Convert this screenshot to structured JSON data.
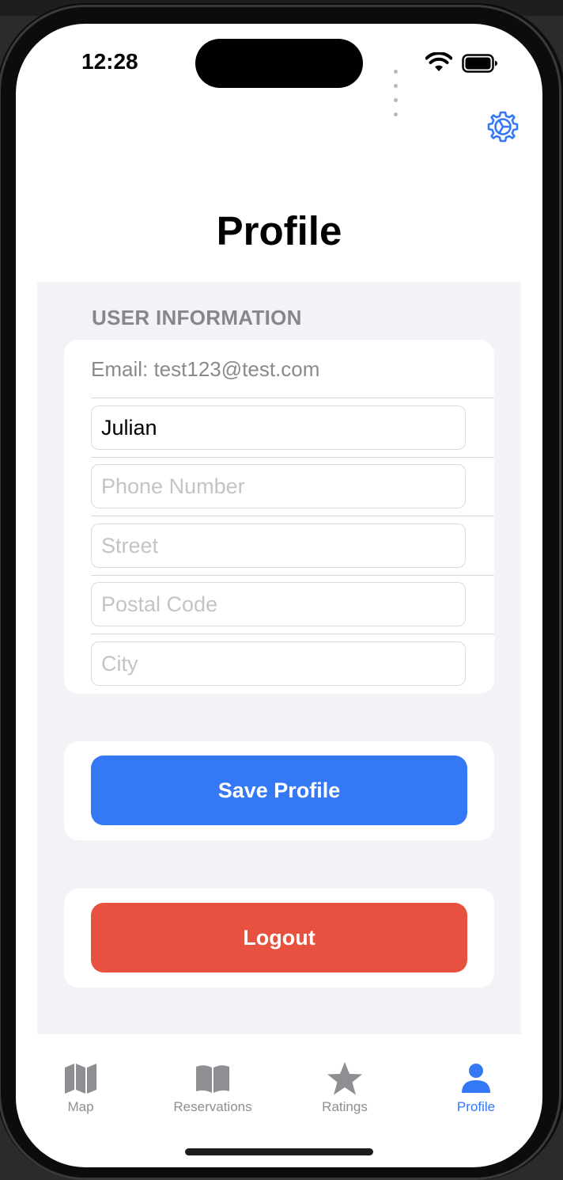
{
  "status_bar": {
    "time": "12:28"
  },
  "header": {
    "title": "Profile",
    "settings_icon": "gear-icon"
  },
  "user_information": {
    "section_header": "USER INFORMATION",
    "email_label": "Email: test123@test.com",
    "fields": {
      "name": {
        "value": "Julian",
        "placeholder": ""
      },
      "phone": {
        "value": "",
        "placeholder": "Phone Number"
      },
      "street": {
        "value": "",
        "placeholder": "Street"
      },
      "postal_code": {
        "value": "",
        "placeholder": "Postal Code"
      },
      "city": {
        "value": "",
        "placeholder": "City"
      }
    }
  },
  "actions": {
    "save_label": "Save Profile",
    "logout_label": "Logout"
  },
  "tab_bar": {
    "items": [
      {
        "label": "Map",
        "icon": "map-icon"
      },
      {
        "label": "Reservations",
        "icon": "book-icon"
      },
      {
        "label": "Ratings",
        "icon": "star-icon"
      },
      {
        "label": "Profile",
        "icon": "person-icon",
        "selected": true
      }
    ]
  },
  "colors": {
    "accent": "#3478f6",
    "danger": "#e85140",
    "grouped_background": "#f2f2f7",
    "inactive_tab": "#8e8e93"
  }
}
